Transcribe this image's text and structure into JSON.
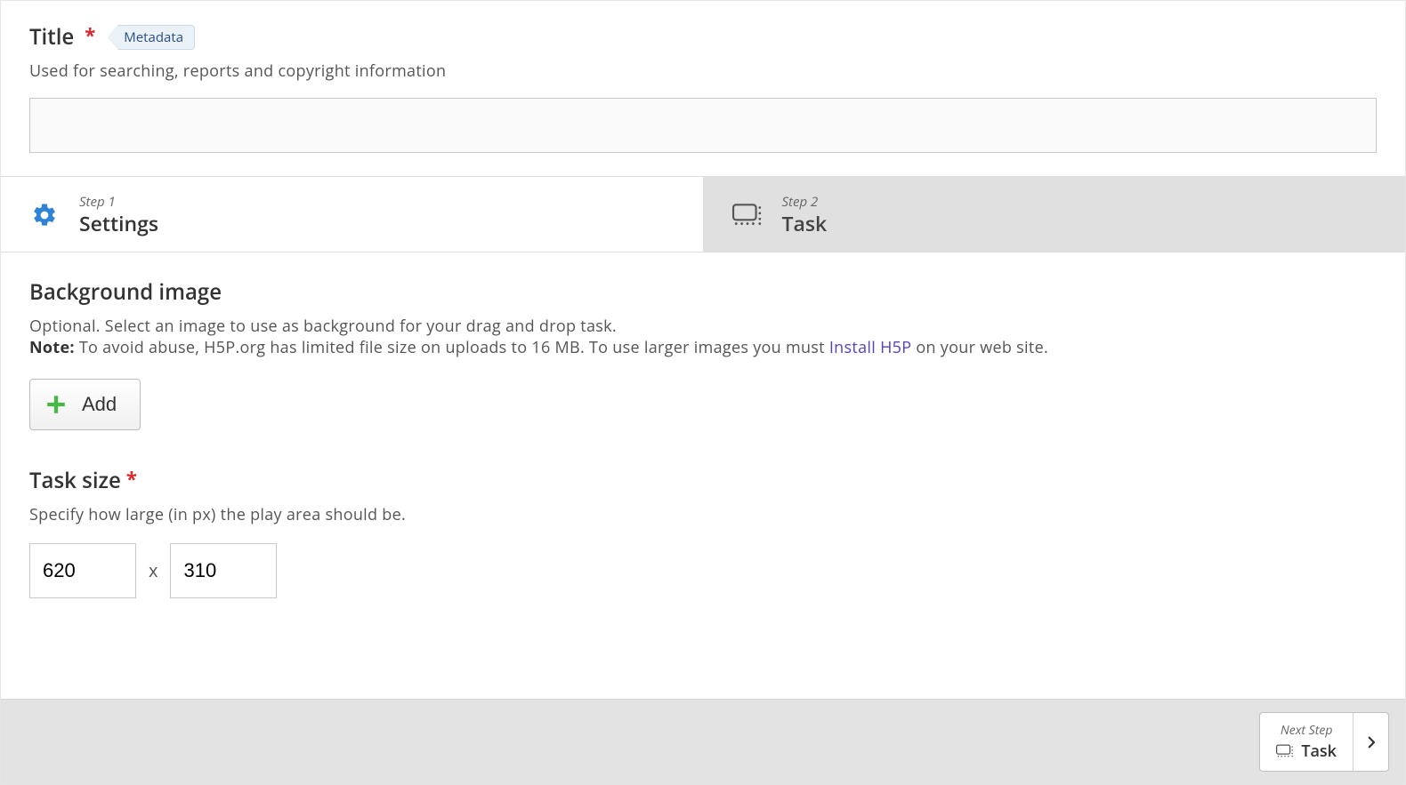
{
  "title": {
    "label": "Title",
    "chip": "Metadata",
    "hint": "Used for searching, reports and copyright information",
    "value": ""
  },
  "steps": {
    "step1_num": "Step 1",
    "step1_name": "Settings",
    "step2_num": "Step 2",
    "step2_name": "Task"
  },
  "background": {
    "heading": "Background image",
    "desc_pre": "Optional. Select an image to use as background for your drag and drop task.",
    "note_label": "Note:",
    "note_text_before_link": " To avoid abuse, H5P.org has limited file size on uploads to 16 MB. To use larger images you must ",
    "link_text": "Install H5P",
    "note_text_after_link": " on your web site.",
    "add_label": "Add"
  },
  "task_size": {
    "heading": "Task size",
    "hint": "Specify how large (in px) the play area should be.",
    "width": "620",
    "height": "310",
    "separator": "x"
  },
  "footer": {
    "next_label": "Next Step",
    "next_target": "Task"
  }
}
